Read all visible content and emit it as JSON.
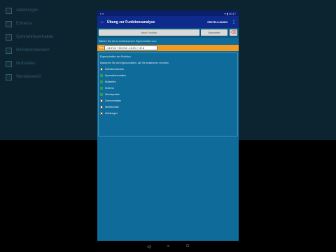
{
  "status": {
    "left": "▪ ▪▪",
    "right": "▾ ▮ 00:17"
  },
  "appbar": {
    "back": "←",
    "title": "Übung zur Funktionsanalyse",
    "action": "ERSTELLUNGEN",
    "menu": "⋮"
  },
  "buttons": {
    "b1": "Neue Funktion",
    "b2": "Bearbeiten",
    "b3": "⌫"
  },
  "hint": "Wählen Sie die zu bestimmenden Eigenschaften aus:",
  "function": {
    "label": "f(x) =",
    "value": "-13.9*x3 + 90.3*x2 - 13.0*x + 47.8"
  },
  "sub1": "Eigenschaften der Funktion",
  "sub2": "Markieren Sie die Eigenschaften, die Sie bestimmen möchten",
  "items": [
    {
      "label": "Definitionsbereich",
      "checked": false
    },
    {
      "label": "Symmetrieverhalten",
      "checked": true
    },
    {
      "label": "Nullstellen",
      "checked": true
    },
    {
      "label": "Extrema",
      "checked": true
    },
    {
      "label": "Wendepunkte",
      "checked": true
    },
    {
      "label": "Grenzverhalten",
      "checked": false
    },
    {
      "label": "Wertebereich",
      "checked": false
    },
    {
      "label": "Ableitungen",
      "checked": false
    }
  ],
  "background_items": [
    {
      "label": "Ableitungen",
      "checked": true
    },
    {
      "label": "Extrema",
      "checked": true
    },
    {
      "label": "Symmetrieverhalten",
      "checked": true
    },
    {
      "label": "Definitionsbereich",
      "checked": false
    },
    {
      "label": "Nullstellen",
      "checked": false
    },
    {
      "label": "Wertebereich",
      "checked": false
    }
  ],
  "nav": {
    "back": "◁",
    "home": "○",
    "recent": "□"
  }
}
